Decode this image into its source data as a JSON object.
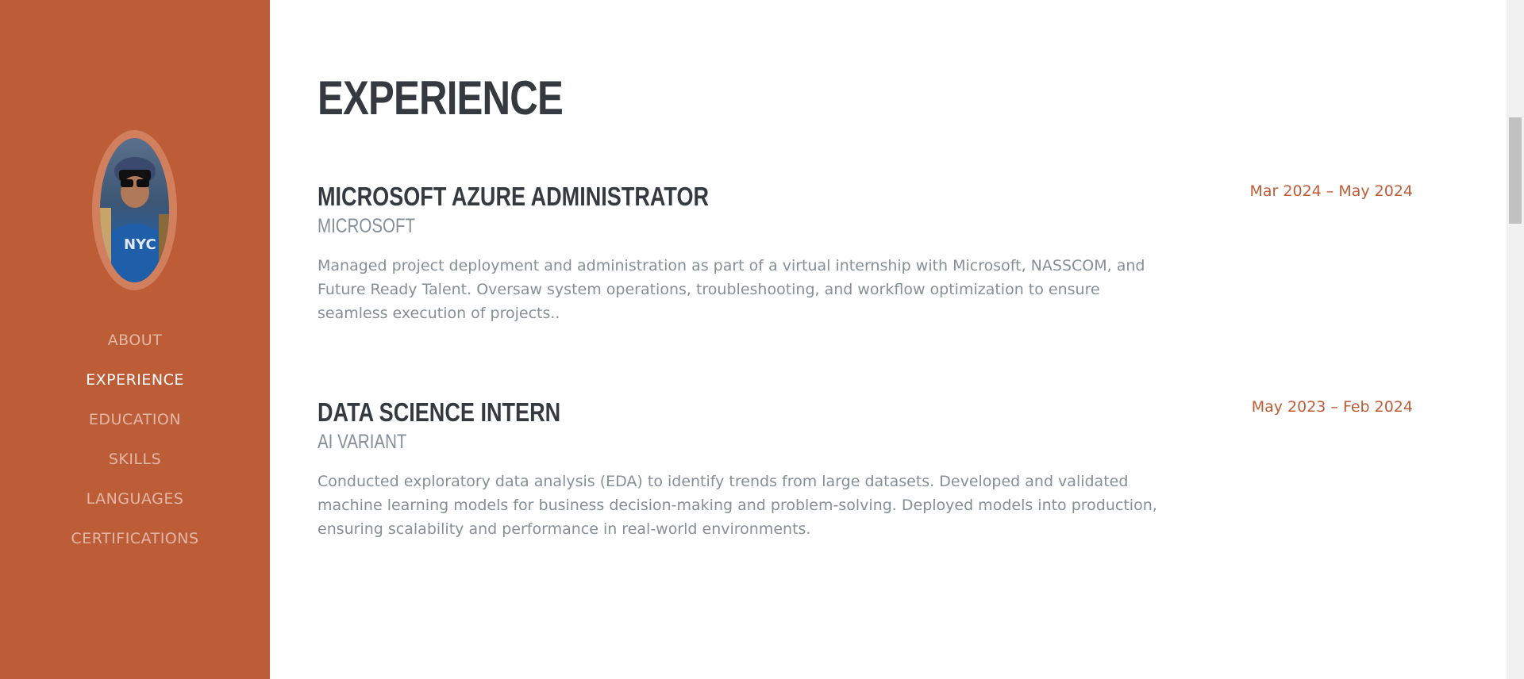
{
  "nav": {
    "items": [
      {
        "label": "ABOUT"
      },
      {
        "label": "EXPERIENCE"
      },
      {
        "label": "EDUCATION"
      },
      {
        "label": "SKILLS"
      },
      {
        "label": "LANGUAGES"
      },
      {
        "label": "CERTIFICATIONS"
      }
    ],
    "active": "EXPERIENCE"
  },
  "section": {
    "title": "EXPERIENCE"
  },
  "experience": [
    {
      "role": "MICROSOFT AZURE ADMINISTRATOR",
      "org": "MICROSOFT",
      "description": "Managed project deployment and administration as part of a virtual internship with Microsoft, NASSCOM, and Future Ready Talent. Oversaw system operations, troubleshooting, and workflow optimization to ensure seamless execution of projects..",
      "date": "Mar 2024 – May 2024"
    },
    {
      "role": "DATA SCIENCE INTERN",
      "org": "AI VARIANT",
      "description": "Conducted exploratory data analysis (EDA) to identify trends from large datasets. Developed and validated machine learning models for business decision-making and problem-solving. Deployed models into production, ensuring scalability and performance in real-world environments.",
      "date": "May 2023 – Feb 2024"
    }
  ],
  "colors": {
    "primary": "#bd5d38",
    "heading": "#343a40",
    "muted": "#868e96"
  },
  "icons": {
    "avatar": "profile-photo"
  }
}
